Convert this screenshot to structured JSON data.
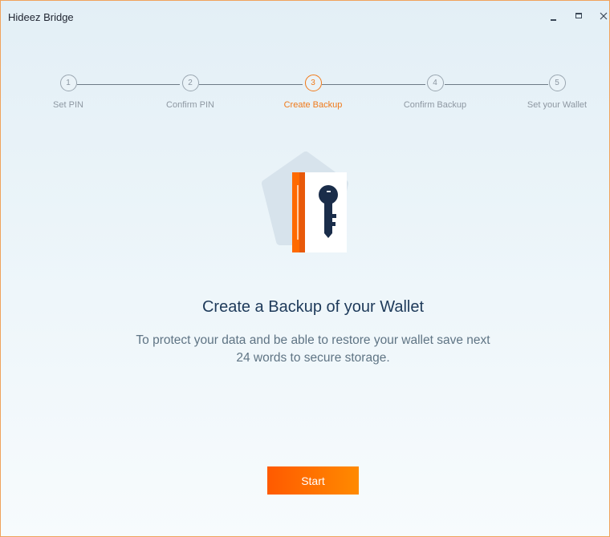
{
  "window": {
    "title": "Hideez Bridge",
    "controls": [
      "minimize-icon",
      "maximize-icon",
      "close-icon"
    ]
  },
  "stepper": {
    "active_step": 3,
    "steps": [
      {
        "number": "1",
        "label": "Set PIN"
      },
      {
        "number": "2",
        "label": "Confirm PIN"
      },
      {
        "number": "3",
        "label": "Create Backup"
      },
      {
        "number": "4",
        "label": "Confirm Backup"
      },
      {
        "number": "5",
        "label": "Set your Wallet"
      }
    ]
  },
  "illustration": {
    "icon": "backup-book-key-icon"
  },
  "main": {
    "heading": "Create a Backup of your Wallet",
    "description_line1": "To protect your data and be able to restore your wallet save next",
    "description_line2": "24 words to secure storage.",
    "start_label": "Start"
  },
  "colors": {
    "accent": "#ff6a00",
    "heading": "#1e3a5a",
    "text": "#5f7484",
    "key": "#1a2d4a"
  }
}
